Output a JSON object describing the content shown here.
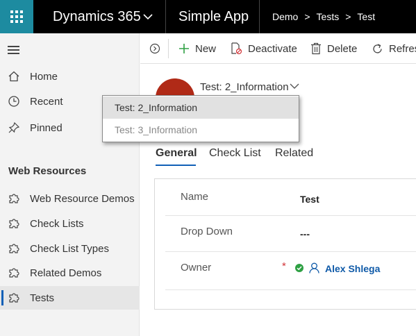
{
  "topbar": {
    "product": "Dynamics 365",
    "app_name": "Simple App",
    "breadcrumb": [
      "Demo",
      "Tests",
      "Test"
    ],
    "brand_color": "#1d8ba0"
  },
  "sidebar": {
    "items": [
      {
        "label": "Home",
        "icon": "home-icon"
      },
      {
        "label": "Recent",
        "icon": "clock-icon"
      },
      {
        "label": "Pinned",
        "icon": "pin-icon"
      }
    ],
    "section_title": "Web Resources",
    "entities": [
      {
        "label": "Web Resource Demos",
        "icon": "puzzle-icon"
      },
      {
        "label": "Check Lists",
        "icon": "puzzle-icon"
      },
      {
        "label": "Check List Types",
        "icon": "puzzle-icon"
      },
      {
        "label": "Related Demos",
        "icon": "puzzle-icon"
      },
      {
        "label": "Tests",
        "icon": "puzzle-icon",
        "active": true
      }
    ]
  },
  "commands": {
    "new": "New",
    "deactivate": "Deactivate",
    "delete": "Delete",
    "refresh": "Refresh"
  },
  "form": {
    "selector_label": "Test: 2_Information",
    "options": [
      "Test: 2_Information",
      "Test: 3_Information"
    ],
    "tabs": [
      "General",
      "Check List",
      "Related"
    ],
    "fields": [
      {
        "label": "Name",
        "value": "Test"
      },
      {
        "label": "Drop Down",
        "value": "---"
      },
      {
        "label": "Owner",
        "value": "Alex Shlega",
        "required_marker": "*"
      }
    ]
  },
  "colors": {
    "accent": "#1160b7",
    "avatar": "#b02a17",
    "required": "#d13438",
    "status_ok": "#2ea043"
  }
}
